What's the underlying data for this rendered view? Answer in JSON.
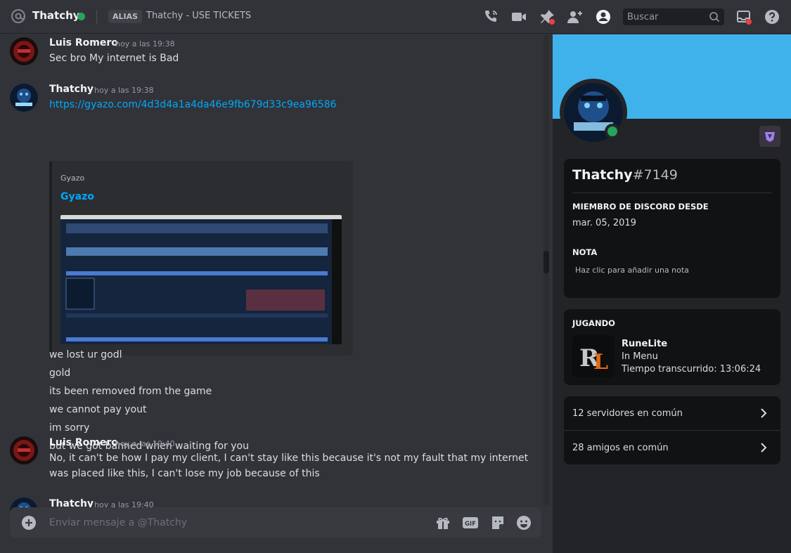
{
  "header": {
    "username": "Thatchy",
    "status_color": "#23a55a",
    "alias_badge": "ALIAS",
    "alias_text": "Thatchy - USE TICKETS",
    "search_placeholder": "Buscar",
    "icons": [
      "at-icon",
      "voice-call-icon",
      "video-call-icon",
      "pin-icon",
      "add-friend-icon",
      "user-profile-icon",
      "search-icon",
      "inbox-icon",
      "help-icon"
    ]
  },
  "messages": [
    {
      "author": "Luis Romero",
      "timestamp": "hoy a las 19:38",
      "lines": [
        "Sec bro My internet is Bad"
      ]
    },
    {
      "author": "Thatchy",
      "timestamp": "hoy a las 19:38",
      "link": "https://gyazo.com/4d3d4a1a4da46e9fb679d33c9ea96586",
      "embed": {
        "provider": "Gyazo",
        "title": "Gyazo"
      },
      "lines": [
        "we lost ur godl",
        "gold",
        "its been removed from the game",
        "we cannot pay yout",
        "im sorry",
        "but we got banned when waiting for you"
      ]
    },
    {
      "author": "Luis Romero",
      "timestamp": "hoy a las 19:40",
      "lines": [
        "No, it can't be how I pay my client, I can't stay like this because it's not my fault that my internet",
        "was placed like this, I can't lose my job because of this"
      ]
    },
    {
      "author": "Thatchy",
      "timestamp": "hoy a las 19:40",
      "lines": []
    }
  ],
  "composer": {
    "placeholder": "Enviar mensaje a @Thatchy",
    "icons": [
      "add-attachment-icon",
      "gift-icon",
      "gif-icon",
      "sticker-icon",
      "emoji-icon"
    ]
  },
  "profile": {
    "banner_color": "#3fb2ec",
    "name": "Thatchy",
    "discriminator": "#7149",
    "member_since_label": "MIEMBRO DE DISCORD DESDE",
    "member_since": "mar. 05, 2019",
    "note_label": "NOTA",
    "note_placeholder": "Haz clic para añadir una nota",
    "playing_label": "JUGANDO",
    "game": {
      "name": "RuneLite",
      "state": "In Menu",
      "elapsed": "Tiempo transcurrido: 13:06:24"
    },
    "mutual_servers": "12 servidores en común",
    "mutual_friends": "28 amigos en común"
  }
}
